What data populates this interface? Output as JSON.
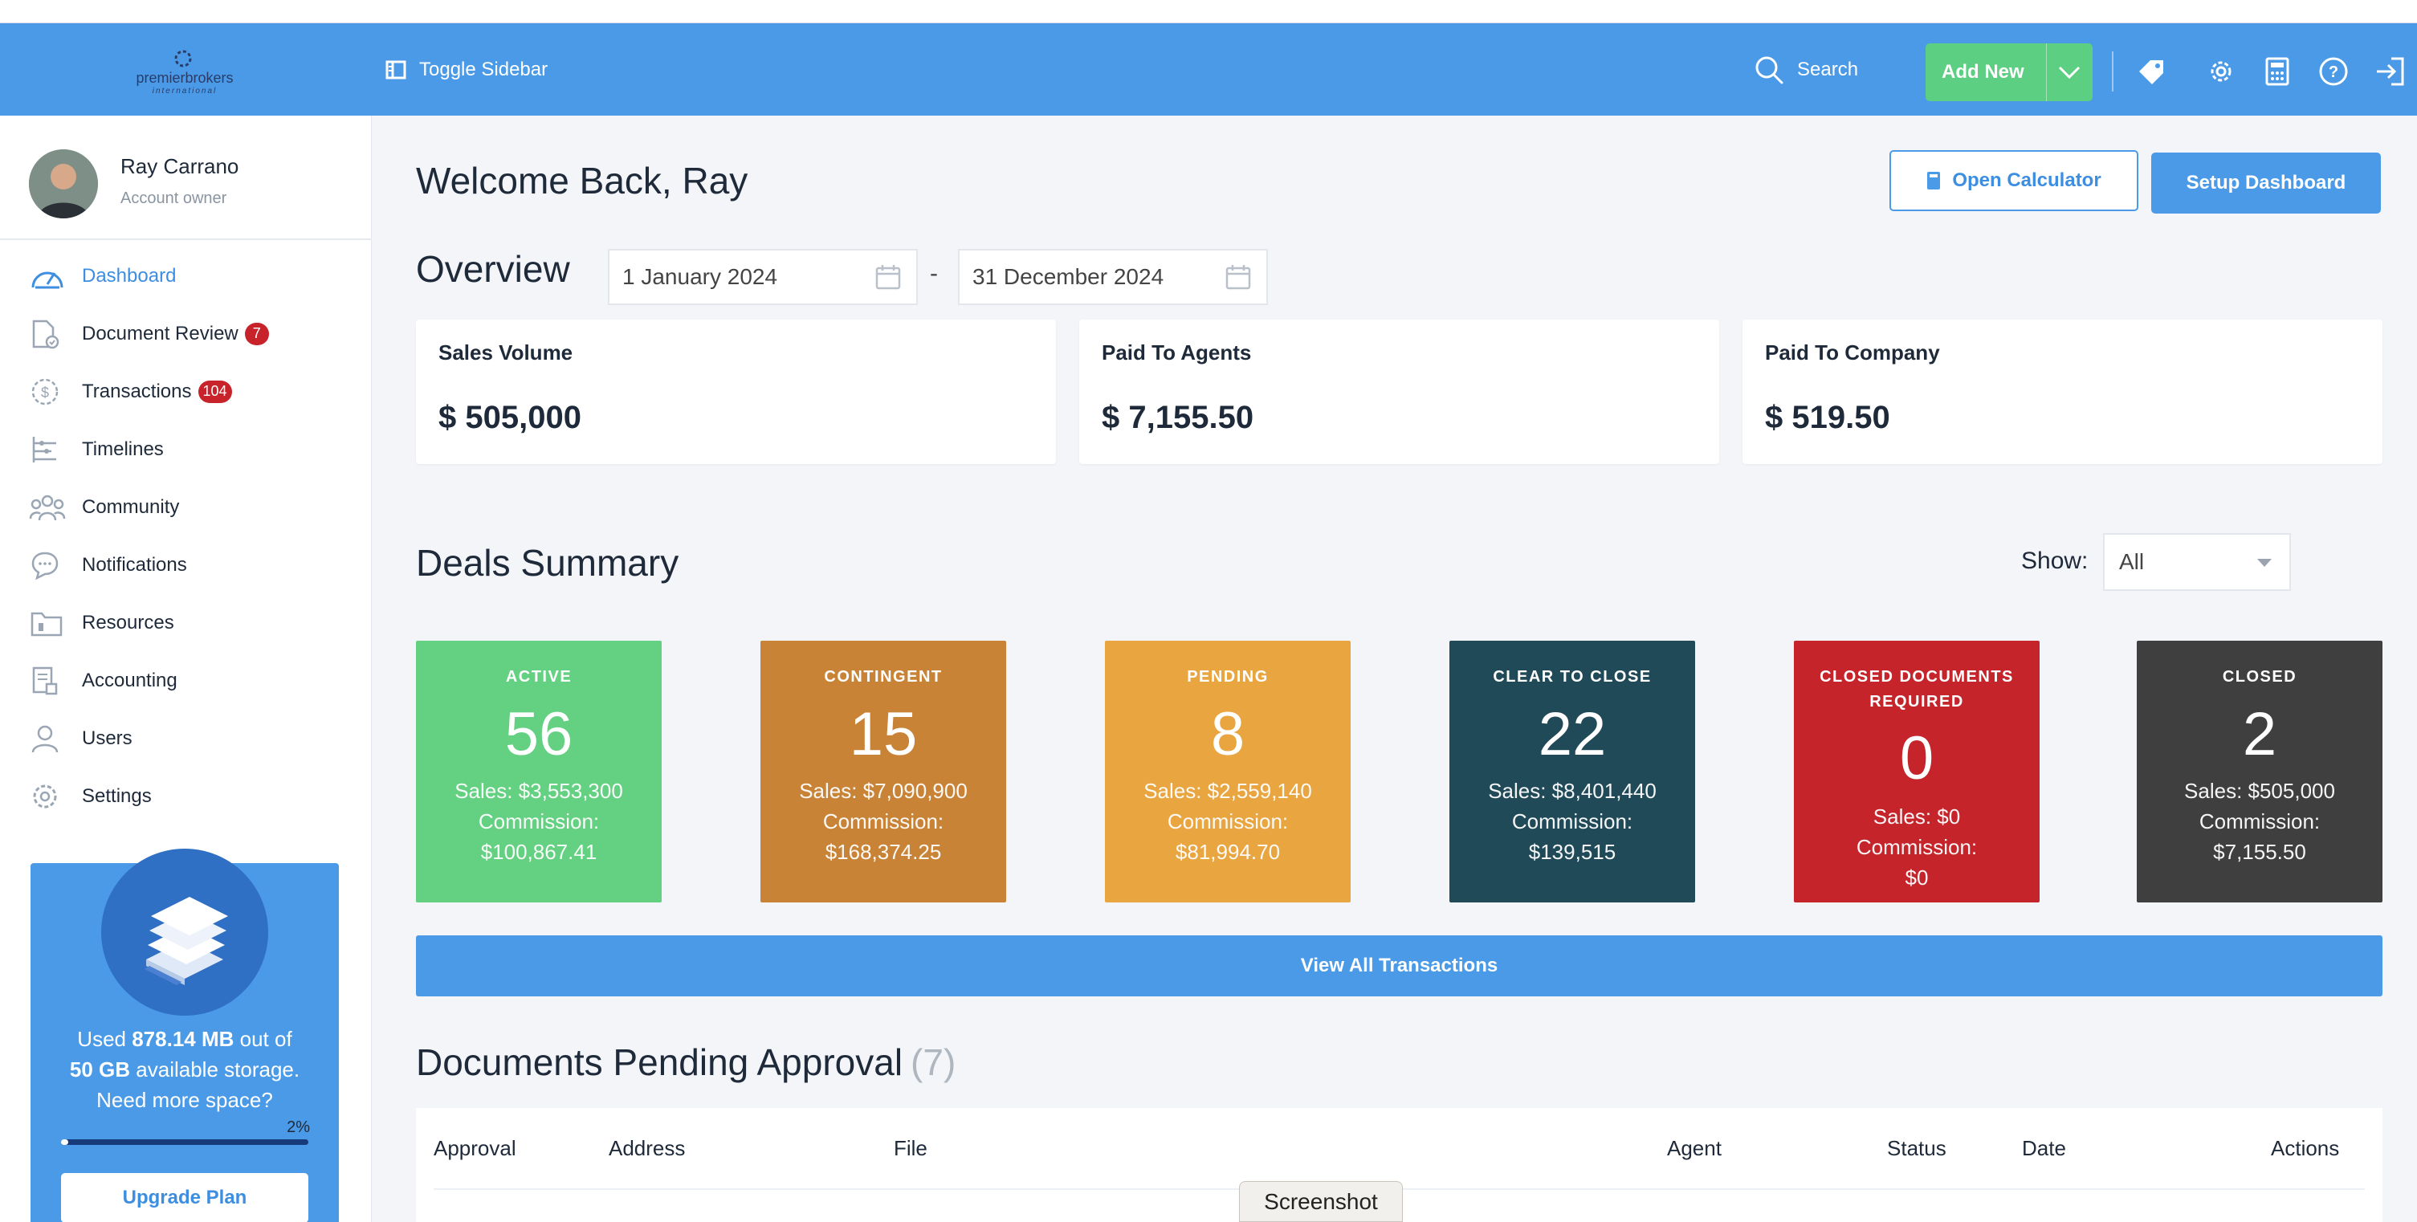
{
  "header": {
    "logo_text": "premierbrokers",
    "logo_sub": "international",
    "toggle_label": "Toggle Sidebar",
    "search_label": "Search",
    "add_new_label": "Add New",
    "icons": [
      "tag-icon",
      "gear-icon",
      "calculator-icon",
      "help-icon",
      "logout-icon"
    ]
  },
  "user": {
    "name": "Ray Carrano",
    "role": "Account owner"
  },
  "sidebar": {
    "items": [
      {
        "label": "Dashboard",
        "icon": "dashboard-gauge-icon",
        "active": true
      },
      {
        "label": "Document Review",
        "icon": "document-check-icon",
        "badge": "7"
      },
      {
        "label": "Transactions",
        "icon": "dollar-circle-icon",
        "badge": "104"
      },
      {
        "label": "Timelines",
        "icon": "timeline-icon"
      },
      {
        "label": "Community",
        "icon": "people-icon"
      },
      {
        "label": "Notifications",
        "icon": "chat-bubble-icon"
      },
      {
        "label": "Resources",
        "icon": "folder-icon"
      },
      {
        "label": "Accounting",
        "icon": "ledger-icon"
      },
      {
        "label": "Users",
        "icon": "user-icon"
      },
      {
        "label": "Settings",
        "icon": "gear-icon"
      }
    ]
  },
  "storage": {
    "used_prefix": "Used ",
    "used_value": "878.14 MB",
    "out_of": " out of",
    "total_value": "50 GB",
    "total_suffix": " available storage.",
    "need_more": "Need more space?",
    "percent_label": "2%",
    "percent": 0.02,
    "upgrade_label": "Upgrade Plan"
  },
  "main": {
    "welcome": "Welcome Back, Ray",
    "open_calculator": "Open Calculator",
    "setup_dashboard": "Setup Dashboard",
    "overview_title": "Overview",
    "date_from": "1 January 2024",
    "date_to": "31 December 2024",
    "date_sep": "-",
    "stats": [
      {
        "label": "Sales Volume",
        "value": "$ 505,000"
      },
      {
        "label": "Paid To Agents",
        "value": "$ 7,155.50"
      },
      {
        "label": "Paid To Company",
        "value": "$ 519.50"
      }
    ],
    "deals_title": "Deals Summary",
    "show_label": "Show:",
    "show_value": "All",
    "deals": [
      {
        "title": "ACTIVE",
        "count": "56",
        "sales": "Sales: $3,553,300",
        "commission_label": "Commission:",
        "commission": "$100,867.41",
        "color": "#64d081"
      },
      {
        "title": "CONTINGENT",
        "count": "15",
        "sales": "Sales: $7,090,900",
        "commission_label": "Commission:",
        "commission": "$168,374.25",
        "color": "#c98336"
      },
      {
        "title": "PENDING",
        "count": "8",
        "sales": "Sales: $2,559,140",
        "commission_label": "Commission:",
        "commission": "$81,994.70",
        "color": "#e8a540"
      },
      {
        "title": "CLEAR TO CLOSE",
        "count": "22",
        "sales": "Sales: $8,401,440",
        "commission_label": "Commission:",
        "commission": "$139,515",
        "color": "#214a59"
      },
      {
        "title": "CLOSED DOCUMENTS REQUIRED",
        "count": "0",
        "sales": "Sales: $0",
        "commission_label": "Commission:",
        "commission": "$0",
        "color": "#c4242a"
      },
      {
        "title": "CLOSED",
        "count": "2",
        "sales": "Sales: $505,000",
        "commission_label": "Commission:",
        "commission": "$7,155.50",
        "color": "#3f3f3f"
      }
    ],
    "view_all": "View All Transactions",
    "docs_title": "Documents Pending Approval",
    "docs_count": "(7)",
    "table_headers": [
      "Approval",
      "Address",
      "File",
      "Agent",
      "Status",
      "Date",
      "Actions"
    ]
  },
  "tooltip": "Screenshot"
}
